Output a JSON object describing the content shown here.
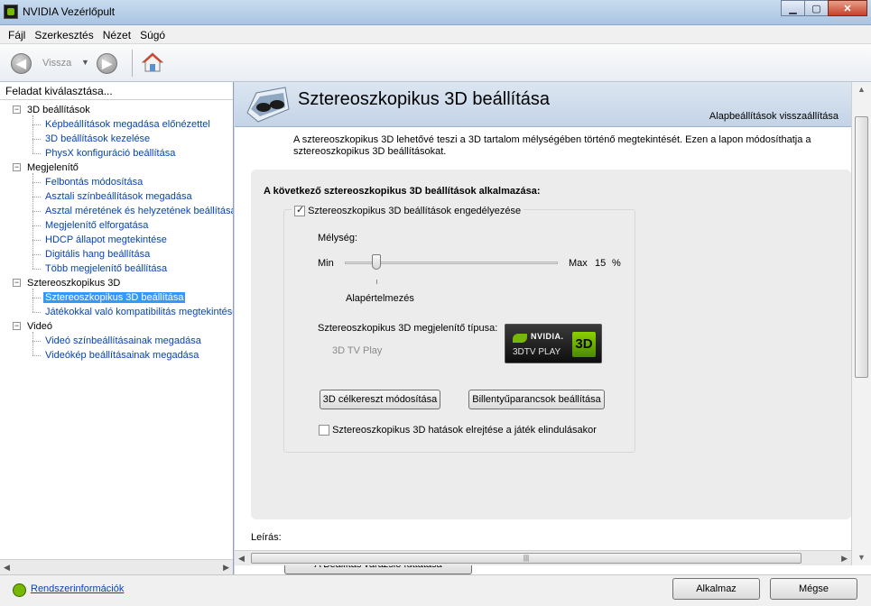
{
  "window": {
    "title": "NVIDIA Vezérlőpult"
  },
  "menu": [
    "Fájl",
    "Szerkesztés",
    "Nézet",
    "Súgó"
  ],
  "toolbar": {
    "back_label": "Vissza"
  },
  "left": {
    "header": "Feladat kiválasztása...",
    "tree": [
      {
        "label": "3D beállítások",
        "items": [
          "Képbeállítások megadása előnézettel",
          "3D beállítások kezelése",
          "PhysX konfiguráció beállítása"
        ]
      },
      {
        "label": "Megjelenítő",
        "items": [
          "Felbontás módosítása",
          "Asztali színbeállítások megadása",
          "Asztal méretének és helyzetének beállítása",
          "Megjelenítő elforgatása",
          "HDCP állapot megtekintése",
          "Digitális hang beállítása",
          "Több megjelenítő beállítása"
        ]
      },
      {
        "label": "Sztereoszkopikus 3D",
        "items": [
          "Sztereoszkopikus 3D beállítása",
          "Játékokkal való kompatibilitás megtekintése"
        ]
      },
      {
        "label": "Videó",
        "items": [
          "Videó színbeállításainak megadása",
          "Videókép beállításainak megadása"
        ]
      }
    ],
    "selected": "Sztereoszkopikus 3D beállítása"
  },
  "main": {
    "title": "Sztereoszkopikus 3D beállítása",
    "restore": "Alapbeállítások visszaállítása",
    "intro": "A sztereoszkopikus 3D lehetővé teszi a 3D tartalom mélységében történő megtekintését. Ezen a lapon módosíthatja a sztereoszkopikus 3D beállításokat.",
    "apply_heading": "A következő sztereoszkopikus 3D beállítások alkalmazása:",
    "enable_label": "Sztereoszkopikus 3D beállítások engedélyezése",
    "enable_checked": true,
    "depth_label": "Mélység:",
    "min_label": "Min",
    "max_label": "Max",
    "depth_value": "15",
    "depth_unit": "%",
    "depth_fraction": 0.15,
    "default_label": "Alapértelmezés",
    "type_label": "Sztereoszkopikus 3D megjelenítő típusa:",
    "type_value": "3D TV Play",
    "badge": {
      "brand": "NVIDIA.",
      "play": "3DTV PLAY",
      "mark": "3D"
    },
    "crosshair_button": "3D célkereszt módosítása",
    "hotkeys_button": "Billentyűparancsok beállítása",
    "hide_label": "Sztereoszkopikus 3D hatások elrejtése a játék elindulásakor",
    "hide_checked": false,
    "wizard_button": "A Beállítás varázsló futtatása",
    "desc_label": "Leírás:"
  },
  "bottom": {
    "sysinfo": "Rendszerinformációk",
    "apply": "Alkalmaz",
    "cancel": "Mégse"
  },
  "colors": {
    "selection": "#3399ff",
    "link": "#0645ad",
    "nvidia_green": "#76b900"
  }
}
